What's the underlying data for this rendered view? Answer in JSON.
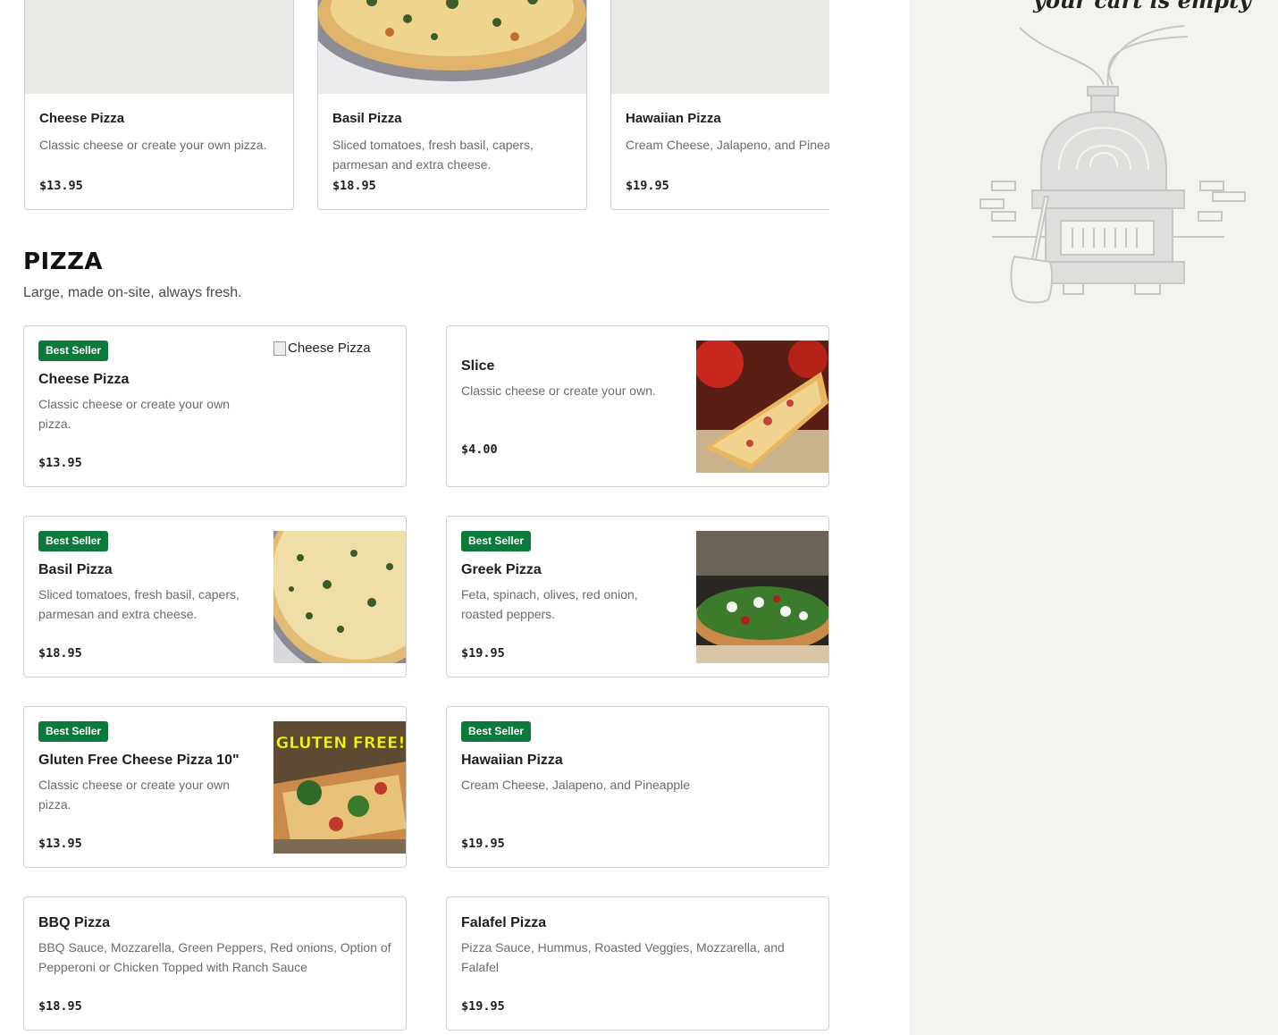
{
  "featured": [
    {
      "name": "Cheese Pizza",
      "description": "Classic cheese or create your own pizza.",
      "price": "$13.95",
      "image": "placeholder"
    },
    {
      "name": "Basil Pizza",
      "description": "Sliced tomatoes, fresh basil, capers, parmesan and extra cheese.",
      "price": "$18.95",
      "image": "basil-pizza-photo"
    },
    {
      "name": "Hawaiian Pizza",
      "description": "Cream Cheese, Jalapeno, and Pineapple",
      "price": "$19.95",
      "image": "placeholder"
    }
  ],
  "section": {
    "title": "PIZZA",
    "subtitle": "Large, made on-site, always fresh."
  },
  "items": [
    {
      "name": "Cheese Pizza",
      "badge": "Best Seller",
      "description": "Classic cheese or create your own pizza.",
      "price": "$13.95",
      "image_alt": "Cheese Pizza"
    },
    {
      "name": "Slice",
      "description": "Classic cheese or create your own.",
      "price": "$4.00",
      "image": "slice-photo"
    },
    {
      "name": "Basil Pizza",
      "badge": "Best Seller",
      "description": "Sliced tomatoes, fresh basil, capers, parmesan and extra cheese.",
      "price": "$18.95",
      "image": "basil-pizza-photo"
    },
    {
      "name": "Greek Pizza",
      "badge": "Best Seller",
      "description": "Feta, spinach, olives, red onion, roasted peppers.",
      "price": "$19.95",
      "image": "greek-pizza-photo"
    },
    {
      "name": "Gluten Free Cheese Pizza 10\"",
      "badge": "Best Seller",
      "description": "Classic cheese or create your own pizza.",
      "price": "$13.95",
      "image": "gluten-free-photo",
      "image_text": "GLUTEN FREE!"
    },
    {
      "name": "Hawaiian Pizza",
      "badge": "Best Seller",
      "description": "Cream Cheese, Jalapeno, and Pineapple",
      "price": "$19.95"
    },
    {
      "name": "BBQ Pizza",
      "description": "BBQ Sauce, Mozzarella, Green Peppers, Red onions, Option of Pepperoni or Chicken Topped with Ranch Sauce",
      "price": "$18.95"
    },
    {
      "name": "Falafel Pizza",
      "description": "Pizza Sauce, Hummus, Roasted Veggies, Mozzarella, and Falafel",
      "price": "$19.95"
    }
  ],
  "cart": {
    "empty_text": "your cart is empty",
    "illustration": "pizza-oven-illustration"
  },
  "colors": {
    "badge": "#0b7a3b",
    "sidebar_bg": "#f4f3f0",
    "border": "#cfcfcf"
  }
}
